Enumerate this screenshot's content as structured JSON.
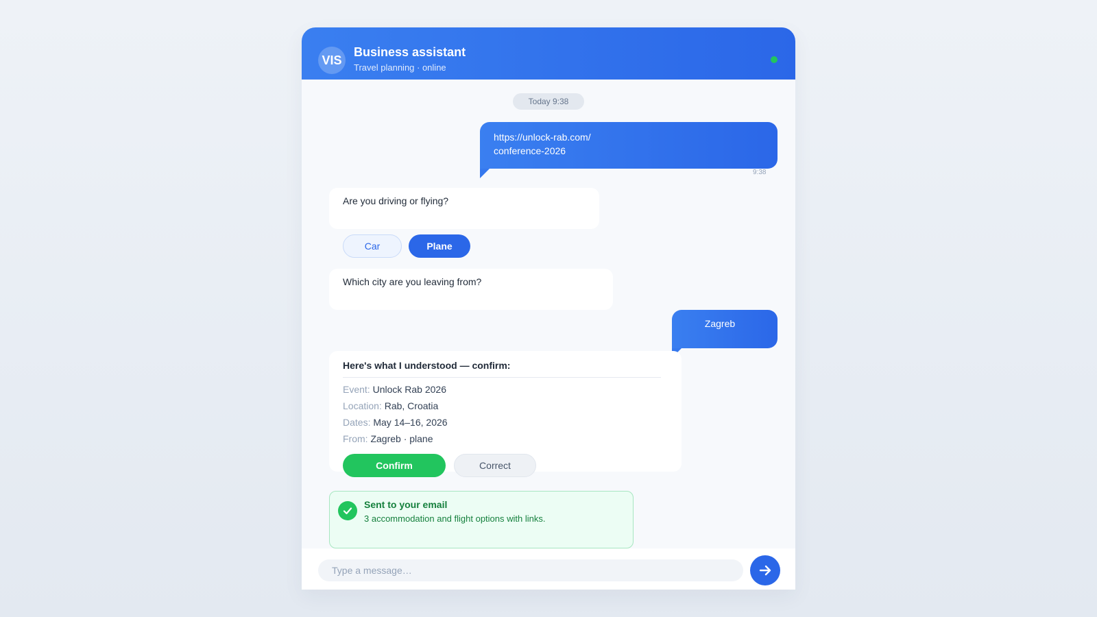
{
  "header": {
    "avatar_initials": "VIS",
    "title": "Business assistant",
    "subtitle": "Travel planning · online",
    "status_color": "#22c55e"
  },
  "chat": {
    "date_label": "Today 9:38",
    "messages": [
      {
        "from": "user",
        "lines": [
          "https://unlock-rab.com/",
          "conference-2026"
        ],
        "time": "9:38"
      },
      {
        "from": "bot",
        "text": "Are you driving or flying?"
      },
      {
        "from": "bot",
        "text": "Which city are you leaving from?"
      },
      {
        "from": "user",
        "text": "Zagreb"
      }
    ],
    "travel_options": [
      {
        "label": "Car",
        "selected": false
      },
      {
        "label": "Plane",
        "selected": true
      }
    ]
  },
  "summary": {
    "heading": "Here's what I understood — confirm:",
    "rows": [
      {
        "label": "Event:",
        "value": "Unlock Rab 2026"
      },
      {
        "label": "Location:",
        "value": "Rab, Croatia"
      },
      {
        "label": "Dates:",
        "value": "May 14–16, 2026"
      },
      {
        "label": "From:",
        "value": "Zagreb · plane"
      }
    ],
    "confirm_label": "Confirm",
    "correct_label": "Correct"
  },
  "notice": {
    "title": "Sent to your email",
    "body": "3 accommodation and flight options with links.",
    "icon": "check-circle-icon"
  },
  "composer": {
    "placeholder": "Type a message…",
    "send_icon": "arrow-right-icon"
  },
  "colors": {
    "accent": "#2b67e8",
    "success": "#22c55e"
  }
}
